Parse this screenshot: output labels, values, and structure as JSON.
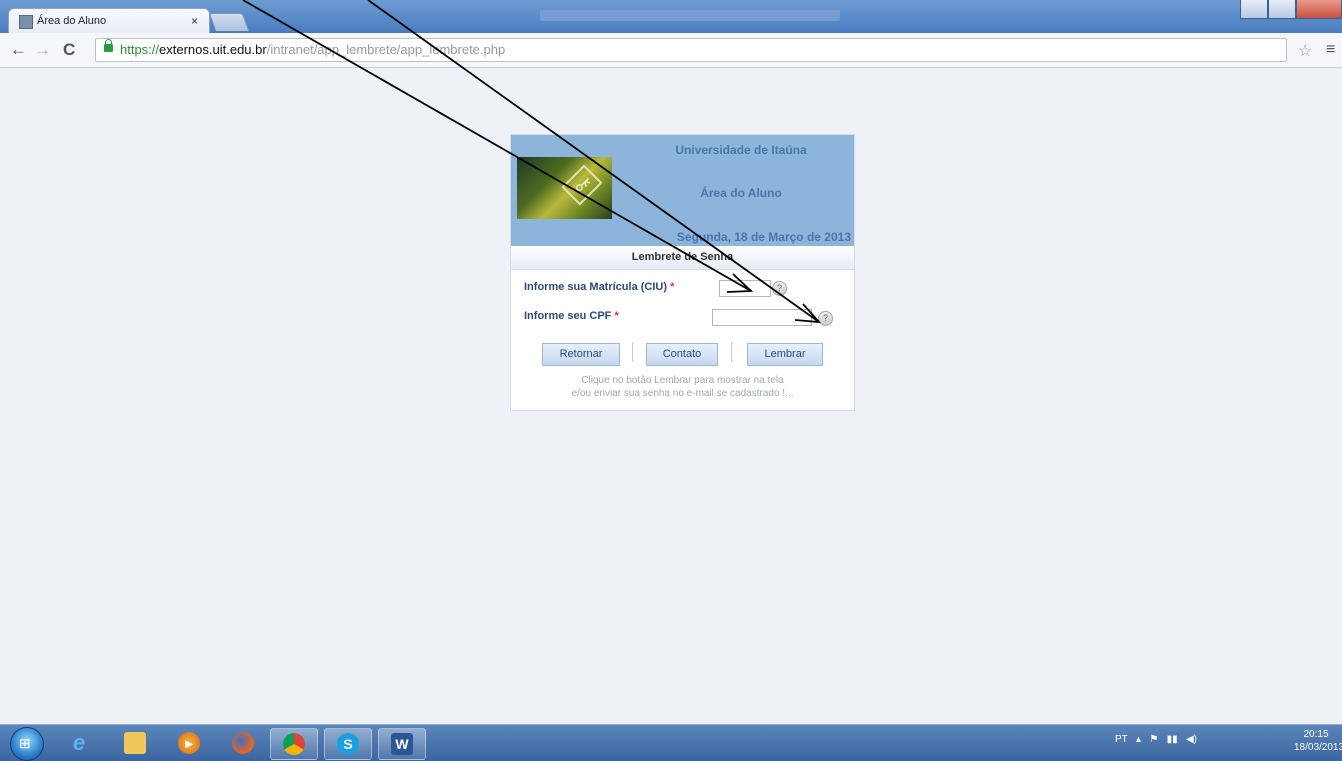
{
  "browser": {
    "tab_title": "Área do Aluno",
    "tab_close": "×",
    "back": "←",
    "forward": "→",
    "reload": "C",
    "url_scheme": "https://",
    "url_host": "externos.uit.edu.br",
    "url_path": "/intranet/app_lembrete/app_lembrete.php",
    "bookmark": "☆",
    "menu": "≡"
  },
  "page": {
    "university": "Universidade de Itaúna",
    "area": "Área do Aluno",
    "date": "Segunda, 18 de Março de 2013",
    "section": "Lembrete de Senha",
    "matricula_label": "Informe sua Matrícula (CIU)",
    "cpf_label": "Informe seu CPF",
    "required_mark": "*",
    "help_mark": "?",
    "matricula_value": "",
    "cpf_value": "",
    "buttons": {
      "retornar": "Retornar",
      "contato": "Contato",
      "lembrar": "Lembrar"
    },
    "hint_line1": "Clique no botão Lembrar para mostrar na tela",
    "hint_line2": "e/ou enviar sua senha no e-mail se cadastrado !..."
  },
  "taskbar": {
    "language": "PT",
    "time": "20:15",
    "date": "18/03/2013",
    "apps": [
      "internet-explorer",
      "file-explorer",
      "media-player",
      "firefox",
      "chrome",
      "skype",
      "word"
    ]
  },
  "colors": {
    "banner": "#8db5dc",
    "banner_text": "#4a76a8",
    "taskbar": "#3b659e"
  }
}
